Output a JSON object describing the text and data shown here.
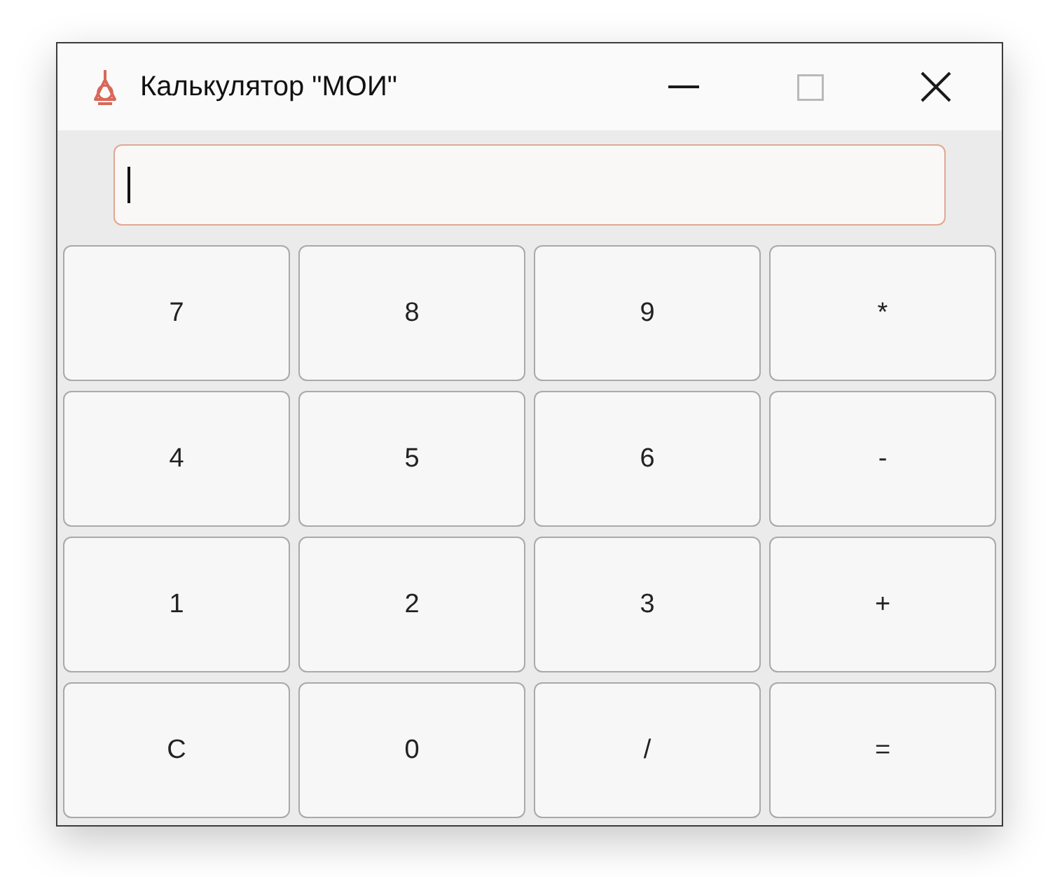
{
  "window": {
    "title": "Калькулятор \"МОИ\"",
    "controls": [
      {
        "kind": "minimize",
        "disabled": false
      },
      {
        "kind": "maximize",
        "disabled": true
      },
      {
        "kind": "close",
        "disabled": false
      }
    ]
  },
  "display": {
    "focused": true
  },
  "keys": [
    "7",
    "8",
    "9",
    "*",
    "4",
    "5",
    "6",
    "-",
    "1",
    "2",
    "3",
    "+",
    "C",
    "0",
    "/",
    "="
  ]
}
